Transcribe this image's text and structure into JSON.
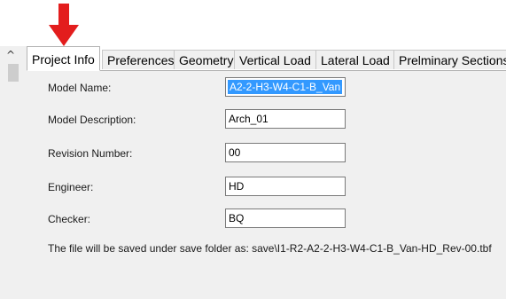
{
  "tabs": [
    {
      "label": "Project Info",
      "active": true
    },
    {
      "label": "Preferences",
      "active": false
    },
    {
      "label": "Geometry",
      "active": false
    },
    {
      "label": "Vertical Load",
      "active": false
    },
    {
      "label": "Lateral Load",
      "active": false
    },
    {
      "label": "Prelminary Sections",
      "active": false
    }
  ],
  "form": {
    "model_name": {
      "label": "Model Name:",
      "value": "A2-2-H3-W4-C1-B_Van"
    },
    "model_description": {
      "label": "Model Description:",
      "value": "Arch_01"
    },
    "revision_number": {
      "label": "Revision Number:",
      "value": "00"
    },
    "engineer": {
      "label": "Engineer:",
      "value": "HD"
    },
    "checker": {
      "label": "Checker:",
      "value": "BQ"
    }
  },
  "save_note": "The file will be saved under save folder as: save\\I1-R2-A2-2-H3-W4-C1-B_Van-HD_Rev-00.tbf",
  "icons": {
    "arrow": "red-down-arrow-icon",
    "scroll_up": "chevron-up-icon"
  },
  "colors": {
    "arrow": "#e31d1d",
    "selection": "#3399ff",
    "panel": "#f0f0f0"
  }
}
